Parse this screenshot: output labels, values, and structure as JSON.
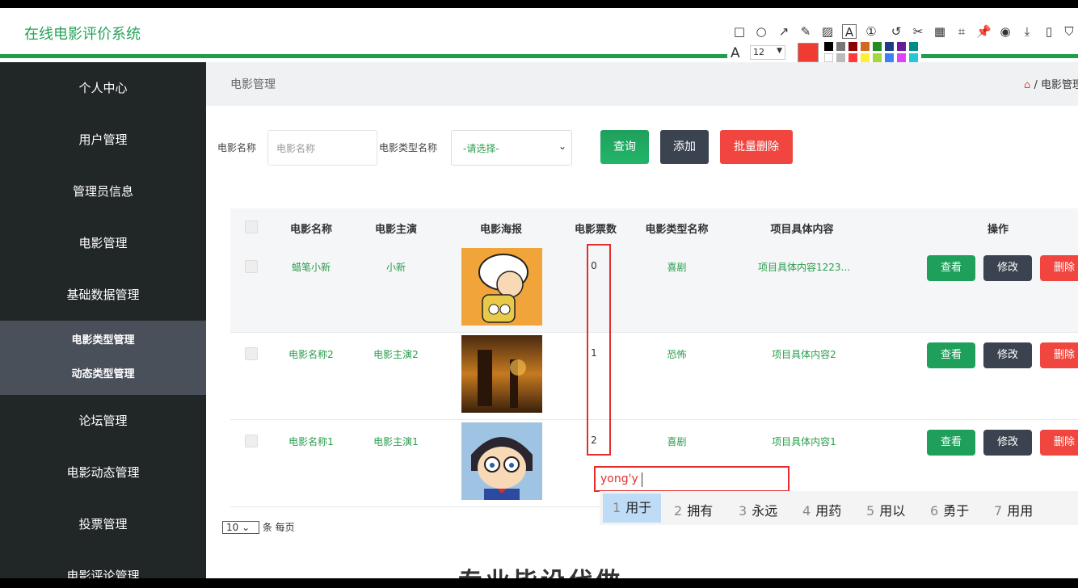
{
  "app": {
    "title": "在线电影评价系统"
  },
  "sidebar": {
    "items": [
      "个人中心",
      "用户管理",
      "管理员信息",
      "电影管理",
      "基础数据管理"
    ],
    "sub_items": [
      "电影类型管理",
      "动态类型管理"
    ],
    "items_after": [
      "论坛管理",
      "电影动态管理",
      "投票管理",
      "电影评论管理"
    ]
  },
  "topbar": {
    "title": "电影管理",
    "breadcrumb_home": "⌂",
    "breadcrumb_sep": "/",
    "breadcrumb_current": "电影管理"
  },
  "search": {
    "name_label": "电影名称",
    "name_placeholder": "电影名称",
    "type_label": "电影类型名称",
    "type_selected": "-请选择-",
    "query_btn": "查询",
    "add_btn": "添加",
    "batch_delete_btn": "批量删除"
  },
  "table": {
    "headers": [
      "电影名称",
      "电影主演",
      "电影海报",
      "电影票数",
      "电影类型名称",
      "项目具体内容",
      "操作"
    ],
    "rows": [
      {
        "name": "蜡笔小新",
        "actor": "小新",
        "votes": "0",
        "type": "喜剧",
        "content": "项目具体内容1223..."
      },
      {
        "name": "电影名称2",
        "actor": "电影主演2",
        "votes": "1",
        "type": "恐怖",
        "content": "项目具体内容2"
      },
      {
        "name": "电影名称1",
        "actor": "电影主演1",
        "votes": "2",
        "type": "喜剧",
        "content": "项目具体内容1"
      }
    ],
    "view_btn": "查看",
    "edit_btn": "修改",
    "delete_btn": "删除"
  },
  "pager": {
    "page_size": "10",
    "suffix": "条 每页"
  },
  "ime": {
    "typed": "yong'y",
    "candidates": [
      {
        "num": "1",
        "word": "用于"
      },
      {
        "num": "2",
        "word": "拥有"
      },
      {
        "num": "3",
        "word": "永远"
      },
      {
        "num": "4",
        "word": "用药"
      },
      {
        "num": "5",
        "word": "用以"
      },
      {
        "num": "6",
        "word": "勇于"
      },
      {
        "num": "7",
        "word": "用用"
      }
    ]
  },
  "bottom_text": "专业毕设代做",
  "annotation_toolbar": {
    "font_label": "A",
    "font_size": "12"
  },
  "colors": {
    "accent_green": "#1f9d4a",
    "query_green": "#1fa05a",
    "add_dark": "#3b4350",
    "delete_red": "#f0463f",
    "annotation_red": "#e52d2d"
  }
}
